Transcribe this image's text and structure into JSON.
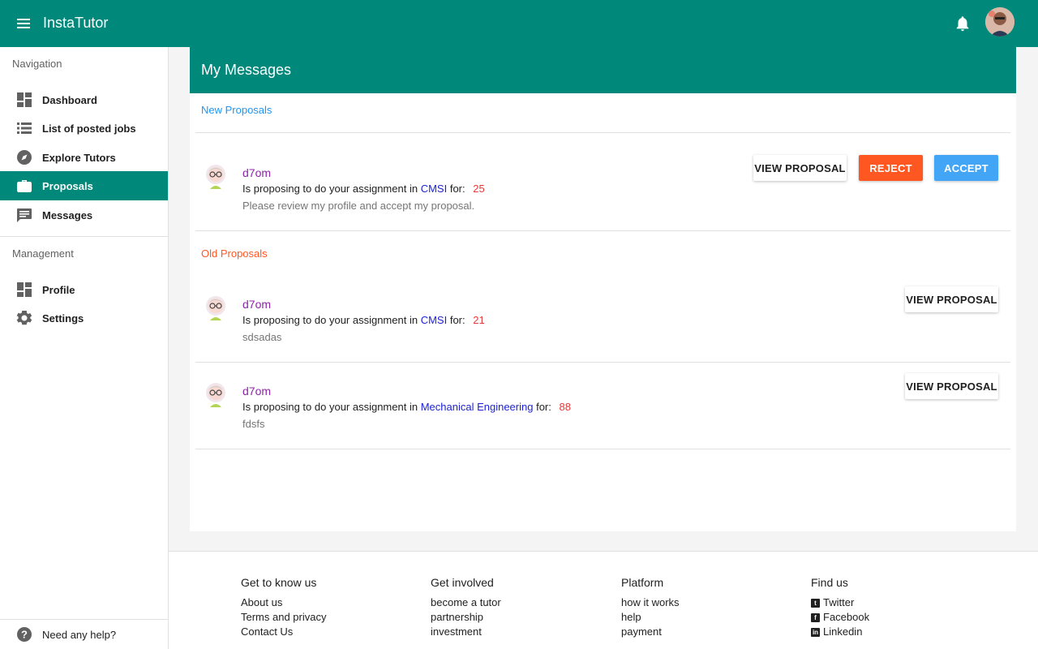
{
  "appbar": {
    "title": "InstaTutor",
    "menu_icon": "menu-icon",
    "bell_icon": "bell-icon",
    "avatar": "user-avatar"
  },
  "sidebar": {
    "navigation_header": "Navigation",
    "nav_items": [
      {
        "label": "Dashboard",
        "icon": "dashboard-icon",
        "active": false
      },
      {
        "label": "List of posted jobs",
        "icon": "list-icon",
        "active": false
      },
      {
        "label": "Explore Tutors",
        "icon": "compass-icon",
        "active": false
      },
      {
        "label": "Proposals",
        "icon": "briefcase-icon",
        "active": true
      },
      {
        "label": "Messages",
        "icon": "message-icon",
        "active": false
      }
    ],
    "management_header": "Management",
    "management_items": [
      {
        "label": "Profile",
        "icon": "dashboard-icon"
      },
      {
        "label": "Settings",
        "icon": "gear-icon"
      }
    ],
    "help_label": "Need any help?"
  },
  "main": {
    "title": "My Messages",
    "new_section_label": "New Proposals",
    "old_section_label": "Old Proposals",
    "new_proposals": [
      {
        "name": "d7om",
        "text": "Is proposing to do your assignment in",
        "subject": "CMSI",
        "for_label": "for:",
        "price": "25",
        "note": "Please review my profile and accept my proposal."
      }
    ],
    "old_proposals": [
      {
        "name": "d7om",
        "text": "Is proposing to do your assignment in",
        "subject": "CMSI",
        "for_label": "for:",
        "price": "21",
        "note": "sdsadas"
      },
      {
        "name": "d7om",
        "text": "Is proposing to do your assignment in",
        "subject": "Mechanical Engineering",
        "for_label": "for:",
        "price": "88",
        "note": "fdsfs"
      }
    ],
    "buttons": {
      "view": "VIEW PROPOSAL",
      "reject": "REJECT",
      "accept": "ACCEPT"
    }
  },
  "footer": {
    "columns": [
      {
        "title": "Get to know us",
        "links": [
          "About us",
          "Terms and privacy",
          "Contact Us"
        ]
      },
      {
        "title": "Get involved",
        "links": [
          "become a tutor",
          "partnership",
          "investment"
        ]
      },
      {
        "title": "Platform",
        "links": [
          "how it works",
          "help",
          "payment"
        ]
      },
      {
        "title": "Find us",
        "links": [
          "Twitter",
          "Facebook",
          "Linkedin"
        ]
      }
    ]
  },
  "colors": {
    "primary": "#00897b",
    "new_label": "#2196f3",
    "old_label": "#ff5722",
    "reject": "#ff5722",
    "accept": "#42a5f5",
    "name": "#8e24aa",
    "subject": "#1e22d6",
    "price": "#e53935"
  }
}
